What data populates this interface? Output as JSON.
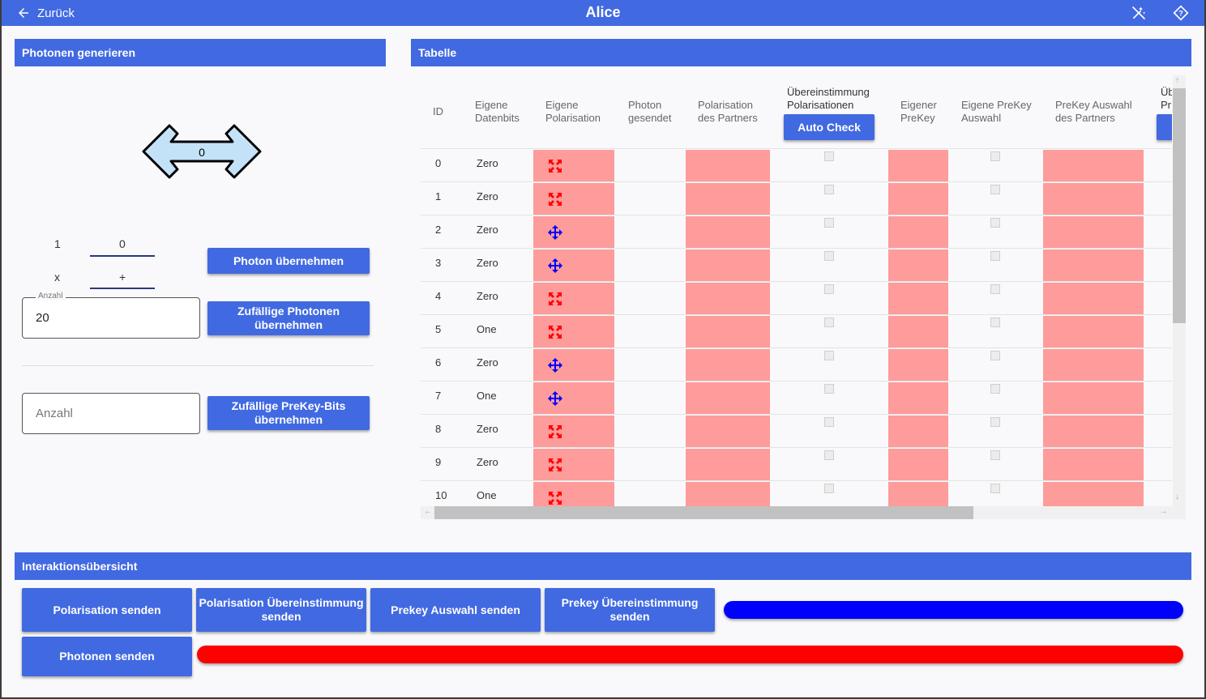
{
  "header": {
    "back_label": "Zurück",
    "title": "Alice"
  },
  "left": {
    "panel_title": "Photonen generieren",
    "arrow_value": "0",
    "val_a": "1",
    "val_b": "0",
    "val_c": "x",
    "val_d": "+",
    "btn_take_photon": "Photon übernehmen",
    "count_label": "Anzahl",
    "count_value": "20",
    "btn_random_photons": "Zufällige Photonen übernehmen",
    "prekey_placeholder": "Anzahl",
    "btn_random_prekey": "Zufällige PreKey-Bits übernehmen"
  },
  "table": {
    "panel_title": "Tabelle",
    "columns": {
      "id": "ID",
      "own_bits": "Eigene Datenbits",
      "own_pol": "Eigene Polarisation",
      "photon_sent": "Photon gesendet",
      "partner_pol": "Polarisation des Partners",
      "match_pol": "Übereinstimmung Polarisationen",
      "own_prekey": "Eigener PreKey",
      "own_prekey_sel": "Eigene PreKey Auswahl",
      "partner_prekey_sel": "PreKey Auswahl des Partners",
      "cut_col": "Üb Pr"
    },
    "auto_check_label": "Auto Check",
    "rows": [
      {
        "id": "0",
        "bits": "Zero",
        "pol": "diagonal"
      },
      {
        "id": "1",
        "bits": "Zero",
        "pol": "diagonal"
      },
      {
        "id": "2",
        "bits": "Zero",
        "pol": "rectilinear"
      },
      {
        "id": "3",
        "bits": "Zero",
        "pol": "rectilinear"
      },
      {
        "id": "4",
        "bits": "Zero",
        "pol": "diagonal"
      },
      {
        "id": "5",
        "bits": "One",
        "pol": "diagonal"
      },
      {
        "id": "6",
        "bits": "Zero",
        "pol": "rectilinear"
      },
      {
        "id": "7",
        "bits": "One",
        "pol": "rectilinear"
      },
      {
        "id": "8",
        "bits": "Zero",
        "pol": "diagonal"
      },
      {
        "id": "9",
        "bits": "Zero",
        "pol": "diagonal"
      },
      {
        "id": "10",
        "bits": "One",
        "pol": "diagonal"
      }
    ]
  },
  "interactions": {
    "panel_title": "Interaktionsübersicht",
    "btn_send_pol": "Polarisation senden",
    "btn_send_pol_match": "Polarisation Übereinstimmung senden",
    "btn_send_prekey_sel": "Prekey Auswahl senden",
    "btn_send_prekey_match": "Prekey Übereinstimmung senden",
    "btn_send_photons": "Photonen senden"
  },
  "colors": {
    "accent": "#4169e1",
    "cell_pink": "#fe9b9b",
    "bar_blue": "#0000ff",
    "bar_red": "#ff0000",
    "icon_red": "#ff0000",
    "icon_blue": "#0000ff"
  },
  "icons": {
    "back": "arrow-left-icon",
    "top_right_1": "magic-wand-off-icon",
    "top_right_2": "help-diamond-icon",
    "diagonal": "diagonal-arrows-icon",
    "rectilinear": "cross-arrows-icon"
  }
}
